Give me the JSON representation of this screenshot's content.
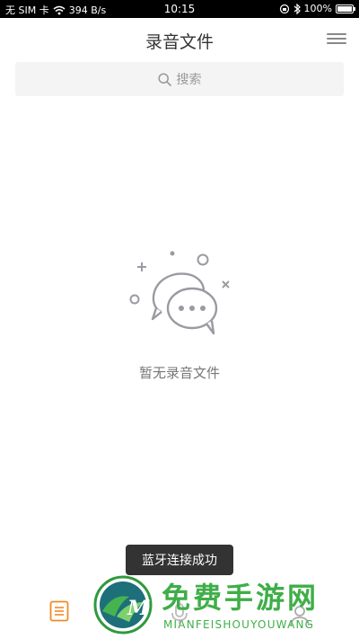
{
  "status_bar": {
    "carrier": "无 SIM 卡",
    "network_speed": "394 B/s",
    "time": "10:15",
    "battery_percent": "100%",
    "battery_level": 1.0
  },
  "header": {
    "title": "录音文件"
  },
  "search": {
    "placeholder": "搜索"
  },
  "empty_state": {
    "message": "暂无录音文件"
  },
  "toast": {
    "message": "蓝牙连接成功"
  },
  "tab_bar": {
    "tabs": [
      {
        "icon": "list-icon",
        "active": true
      },
      {
        "icon": "microphone-icon",
        "active": false
      },
      {
        "icon": "user-icon",
        "active": false
      }
    ],
    "accent_color": "#f08a24"
  },
  "watermark": {
    "title": "免费手游网",
    "subtitle": "MIANFEISHOUYOUWANG",
    "color": "#3fae48"
  }
}
